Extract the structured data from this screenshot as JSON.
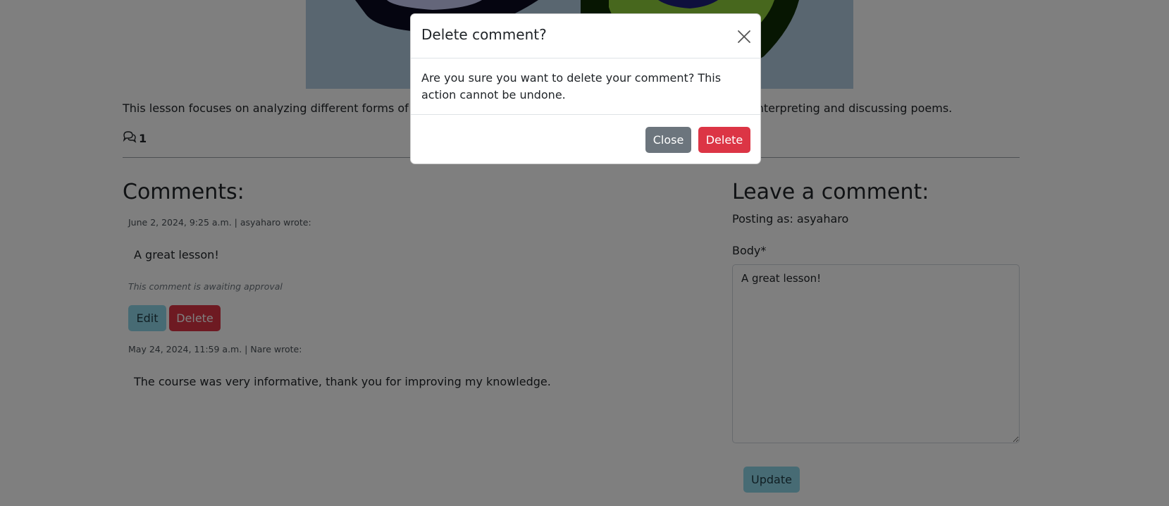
{
  "lesson": {
    "description": "This lesson focuses on analyzing different forms of poetry, understand their structures and styles, and practice interpreting and discussing poems.",
    "comment_count": "1"
  },
  "comments_section": {
    "heading": "Comments:",
    "comments": [
      {
        "meta": "June 2, 2024, 9:25 a.m. | asyaharo wrote:",
        "body": "A great lesson!",
        "status": "This comment is awaiting approval",
        "edit_label": "Edit",
        "delete_label": "Delete"
      },
      {
        "meta": "May 24, 2024, 11:59 a.m. | Nare wrote:",
        "body": "The course was very informative, thank you for improving my knowledge."
      }
    ]
  },
  "comment_form": {
    "heading": "Leave a comment:",
    "posting_as": "Posting as: asyaharo",
    "body_label": "Body*",
    "body_value": "A great lesson!",
    "submit_label": "Update"
  },
  "modal": {
    "title": "Delete comment?",
    "message": "Are you sure you want to delete your comment? This action cannot be undone.",
    "close_label": "Close",
    "delete_label": "Delete"
  },
  "icons": {
    "comments": "comments-icon",
    "close": "close-icon"
  },
  "colors": {
    "danger": "#dc3545",
    "secondary": "#6c757d",
    "info": "#8fd6e8"
  }
}
